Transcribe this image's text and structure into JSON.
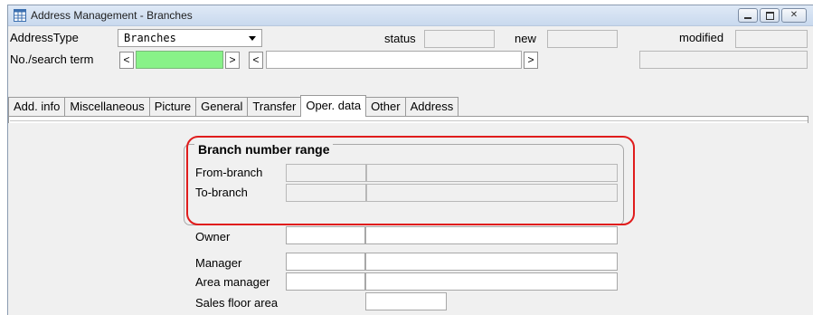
{
  "window": {
    "title": "Address Management - Branches",
    "icon": "grid-table-icon",
    "controls": [
      "minimize-icon",
      "maximize-icon",
      "close-icon"
    ]
  },
  "toolbar": {
    "address_type_label": "AddressType",
    "address_type_value": "Branches",
    "status_label": "status",
    "new_label": "new",
    "modified_label": "modified",
    "search_label": "No./search term",
    "prev_symbol": "<",
    "next_symbol": ">",
    "search_field_color": "#88f288"
  },
  "tabs": [
    {
      "label": "Add. info",
      "active": false
    },
    {
      "label": "Miscellaneous",
      "active": false
    },
    {
      "label": "Picture",
      "active": false
    },
    {
      "label": "General",
      "active": false
    },
    {
      "label": "Transfer",
      "active": false
    },
    {
      "label": "Oper. data",
      "active": true
    },
    {
      "label": "Other",
      "active": false
    },
    {
      "label": "Address",
      "active": false
    }
  ],
  "branch_range": {
    "title": "Branch number range",
    "from_label": "From-branch",
    "to_label": "To-branch"
  },
  "fields": {
    "owner_label": "Owner",
    "manager_label": "Manager",
    "area_manager_label": "Area manager",
    "sales_floor_label": "Sales floor area"
  },
  "highlight_color": "#e01c1c"
}
